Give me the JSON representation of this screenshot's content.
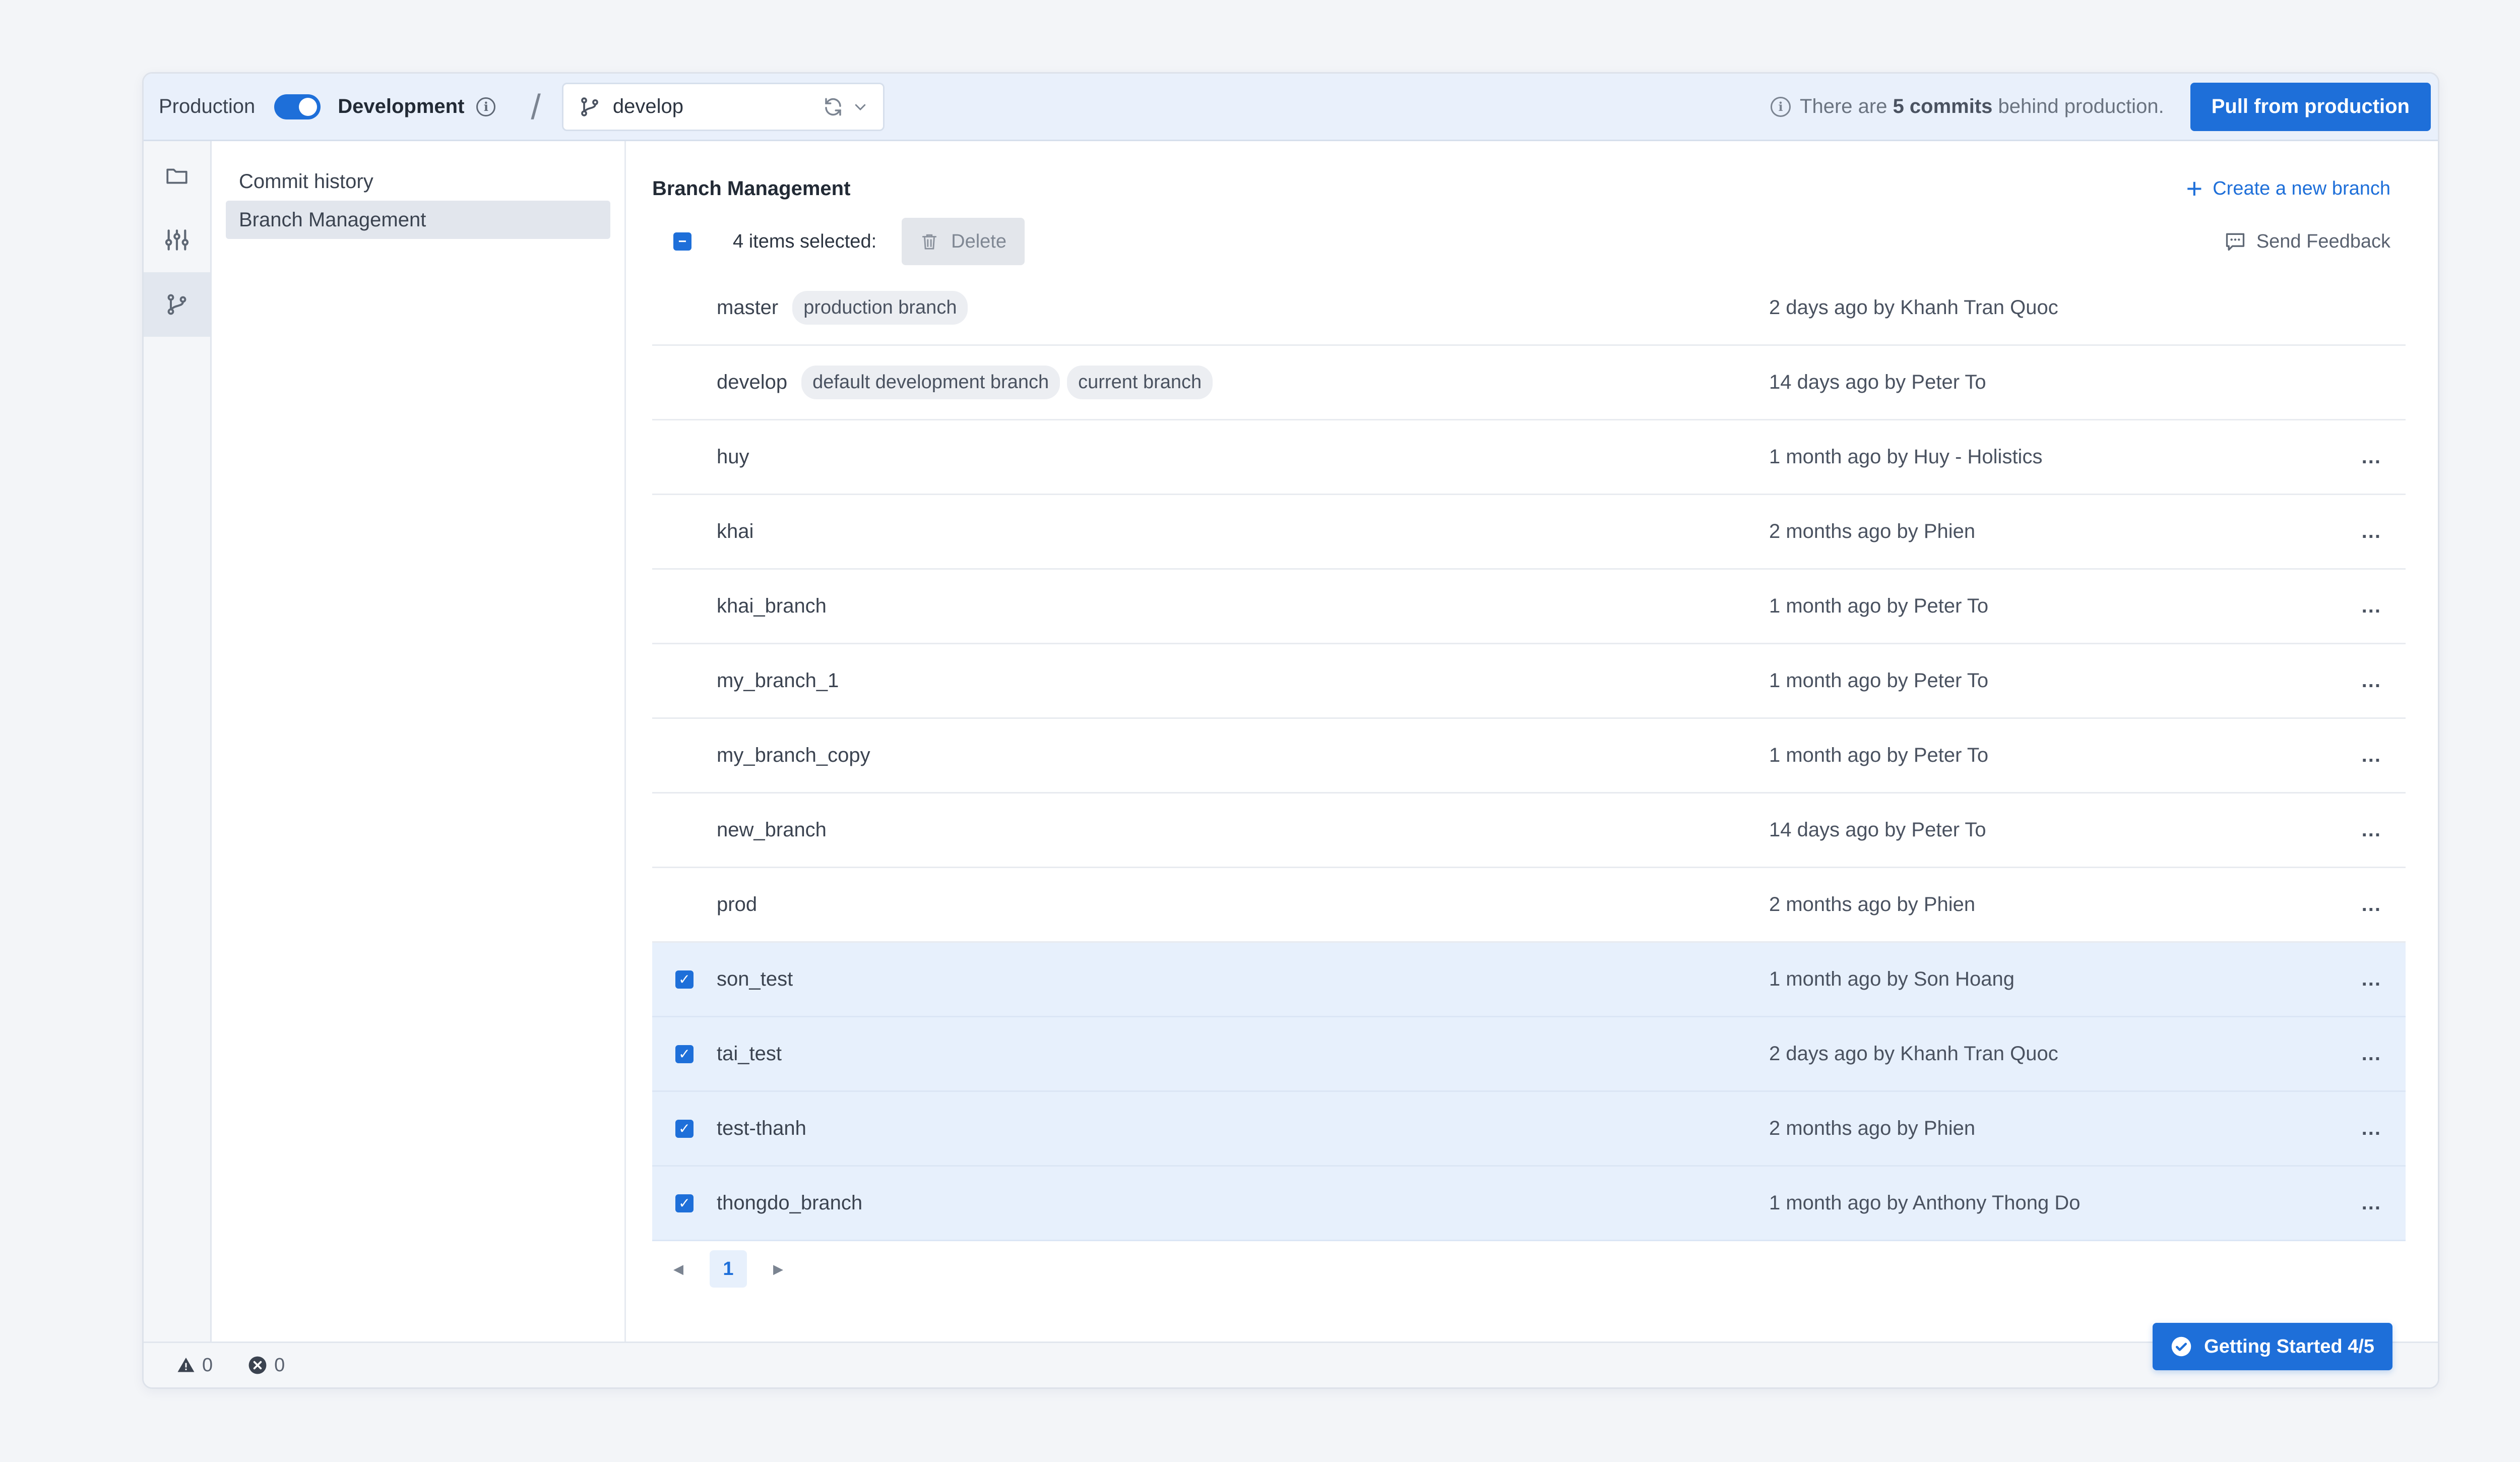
{
  "topbar": {
    "production_label": "Production",
    "development_label": "Development",
    "current_branch": "develop",
    "behind_prefix": "There are ",
    "behind_count": "5 commits",
    "behind_suffix": " behind production.",
    "pull_button": "Pull from production"
  },
  "rail": {
    "items": [
      "folder-icon",
      "sliders-icon",
      "git-branch-icon"
    ],
    "active": "git-branch-icon"
  },
  "subnav": {
    "items": [
      {
        "label": "Commit history"
      },
      {
        "label": "Branch Management"
      }
    ],
    "active": "Branch Management"
  },
  "main": {
    "title": "Branch Management",
    "create_link": "Create a new branch",
    "selected_count": "4 items selected:",
    "delete_button": "Delete",
    "feedback_link": "Send Feedback",
    "branches": [
      {
        "name": "master",
        "tags": [
          "production branch"
        ],
        "updated": "2 days ago by Khanh Tran Quoc",
        "selected": false,
        "actions": false
      },
      {
        "name": "develop",
        "tags": [
          "default development branch",
          "current branch"
        ],
        "updated": "14 days ago by Peter To",
        "selected": false,
        "actions": false
      },
      {
        "name": "huy",
        "tags": [],
        "updated": "1 month ago by Huy - Holistics",
        "selected": false,
        "actions": true
      },
      {
        "name": "khai",
        "tags": [],
        "updated": "2 months ago by Phien",
        "selected": false,
        "actions": true
      },
      {
        "name": "khai_branch",
        "tags": [],
        "updated": "1 month ago by Peter To",
        "selected": false,
        "actions": true
      },
      {
        "name": "my_branch_1",
        "tags": [],
        "updated": "1 month ago by Peter To",
        "selected": false,
        "actions": true
      },
      {
        "name": "my_branch_copy",
        "tags": [],
        "updated": "1 month ago by Peter To",
        "selected": false,
        "actions": true
      },
      {
        "name": "new_branch",
        "tags": [],
        "updated": "14 days ago by Peter To",
        "selected": false,
        "actions": true
      },
      {
        "name": "prod",
        "tags": [],
        "updated": "2 months ago by Phien",
        "selected": false,
        "actions": true
      },
      {
        "name": "son_test",
        "tags": [],
        "updated": "1 month ago by Son Hoang",
        "selected": true,
        "actions": true
      },
      {
        "name": "tai_test",
        "tags": [],
        "updated": "2 days ago by Khanh Tran Quoc",
        "selected": true,
        "actions": true
      },
      {
        "name": "test-thanh",
        "tags": [],
        "updated": "2 months ago by Phien",
        "selected": true,
        "actions": true
      },
      {
        "name": "thongdo_branch",
        "tags": [],
        "updated": "1 month ago by Anthony Thong Do",
        "selected": true,
        "actions": true
      }
    ],
    "more_label": "...",
    "pagination": {
      "current_page": "1"
    }
  },
  "statusbar": {
    "warnings": "0",
    "errors": "0",
    "getting_started": "Getting Started 4/5"
  },
  "colors": {
    "accent": "#1e6fd9",
    "selected_row": "#e7f0fc",
    "topbar_bg": "#e9f0fb"
  }
}
